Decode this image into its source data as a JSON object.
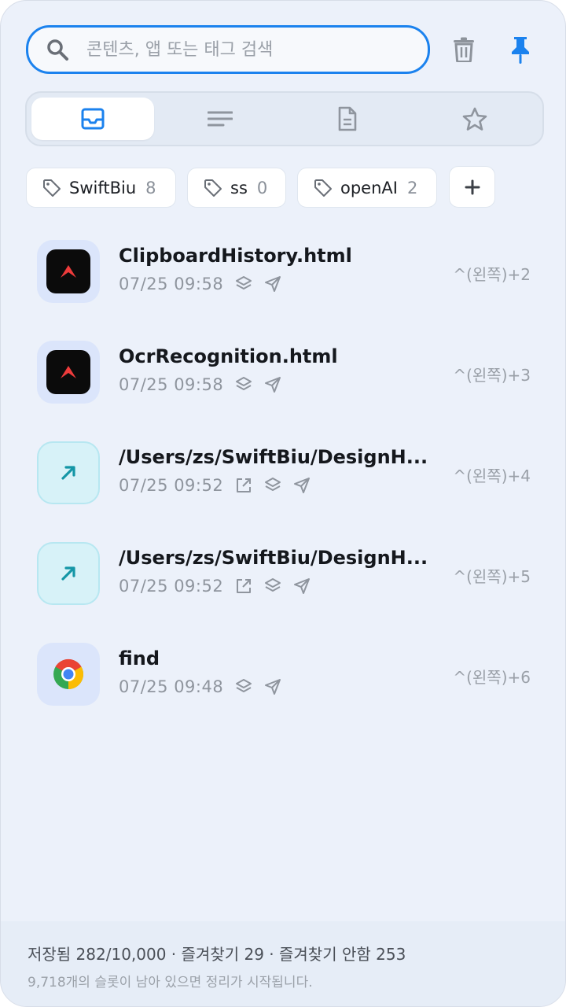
{
  "search": {
    "placeholder": "콘텐츠, 앱 또는 태그 검색",
    "value": ""
  },
  "toolbar": {
    "delete_icon": "trash-icon",
    "pin_icon": "pin-icon",
    "accent_color": "#1b82ee"
  },
  "tabs": [
    {
      "icon": "inbox-icon",
      "active": true
    },
    {
      "icon": "text-lines-icon",
      "active": false
    },
    {
      "icon": "document-icon",
      "active": false
    },
    {
      "icon": "star-icon",
      "active": false
    }
  ],
  "tags": [
    {
      "label": "SwiftBiu",
      "count": "8"
    },
    {
      "label": "ss",
      "count": "0"
    },
    {
      "label": "openAI",
      "count": "2"
    }
  ],
  "items": [
    {
      "title": "ClipboardHistory.html",
      "time": "07/25 09:58",
      "shortcut": "^(왼쪽)+2",
      "app_icon": "app-logo-icon"
    },
    {
      "title": "OcrRecognition.html",
      "time": "07/25 09:58",
      "shortcut": "^(왼쪽)+3",
      "app_icon": "app-logo-icon"
    },
    {
      "title": "/Users/zs/SwiftBiu/DesignH...",
      "time": "07/25 09:52",
      "shortcut": "^(왼쪽)+4",
      "app_icon": "link-arrow-icon"
    },
    {
      "title": "/Users/zs/SwiftBiu/DesignH...",
      "time": "07/25 09:52",
      "shortcut": "^(왼쪽)+5",
      "app_icon": "link-arrow-icon"
    },
    {
      "title": "find",
      "time": "07/25 09:48",
      "shortcut": "^(왼쪽)+6",
      "app_icon": "chrome-icon"
    }
  ],
  "footer": {
    "stats": "저장됨 282/10,000 · 즐겨찾기 29 · 즐겨찾기 안함 253",
    "hint": "9,718개의 슬롯이 남아 있으면 정리가 시작됩니다."
  }
}
